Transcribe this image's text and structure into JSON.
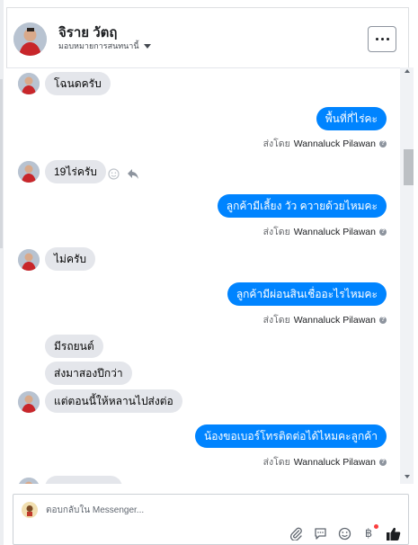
{
  "header": {
    "contact_name": "จิราย วัตฤ",
    "assign_label": "มอบหมายการสนทนานี้"
  },
  "messages": {
    "m1": "โฉนดครับ",
    "m2": "พื้นที่กี่ไร่คะ",
    "m3": "19ไร่ครับ",
    "m4": "ลูกค้ามีเลี้ยง วัว ควายด้วยไหมคะ",
    "m5": "ไม่ครับ",
    "m6": "ลูกค้ามีผ่อนสินเชื่ออะไรไหมคะ",
    "m7": "มีรถยนต์",
    "m8": "ส่งมาสองปีกว่า",
    "m9": "แต่ตอนนี้ให้หลานไปส่งต่อ",
    "m10": "น้องขอเบอร์โทรติดต่อได้ไหมคะลูกค้า"
  },
  "sent_by": {
    "prefix": "ส่งโดย",
    "agent": "Wannaluck Pilawan"
  },
  "composer": {
    "placeholder": "ตอบกลับใน Messenger..."
  },
  "colors": {
    "outgoing_bubble": "#0084ff",
    "incoming_bubble": "#e4e6eb",
    "like_button": "#1c1e21"
  },
  "icons": [
    "more-icon",
    "caret-down-icon",
    "emoji-icon",
    "reply-icon",
    "info-icon",
    "attach-icon",
    "saved-reply-icon",
    "emoji-picker-icon",
    "baht-icon",
    "like-icon"
  ]
}
